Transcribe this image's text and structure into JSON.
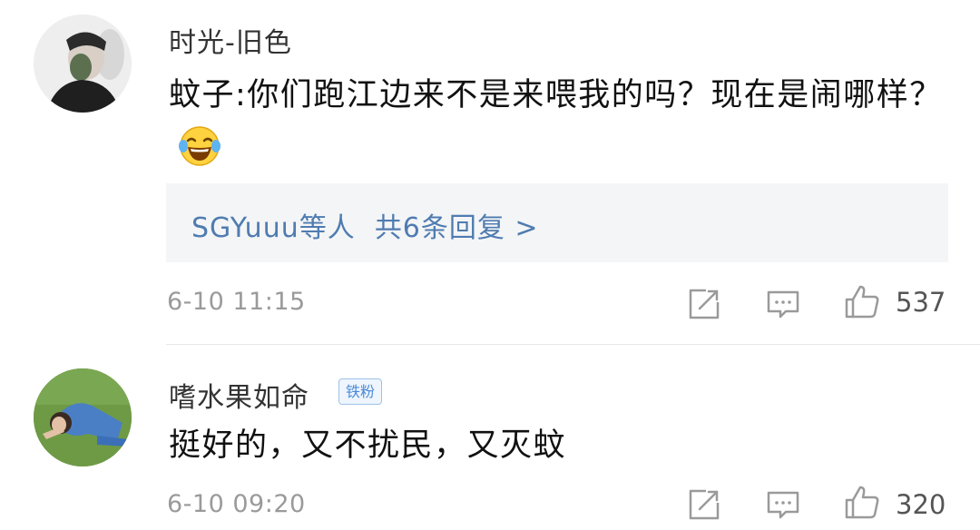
{
  "comments": [
    {
      "username": "时光-旧色",
      "text": "蚊子:你们跑江边来不是来喂我的吗？现在是闹哪样？",
      "emoji": "laughing-tears-emoji",
      "replies_prefix": "SGYuuu等人",
      "replies_count_text": "共6条回复 >",
      "timestamp": "6-10 11:15",
      "likes": "537"
    },
    {
      "username": "嗜水果如命",
      "badge": "铁粉",
      "text": "挺好的，又不扰民，又灭蚊",
      "timestamp": "6-10 09:20",
      "likes": "320"
    }
  ],
  "icons": {
    "share": "share-icon",
    "comment": "comment-icon",
    "like": "thumbs-up-icon"
  },
  "colors": {
    "link": "#4f7cb0",
    "meta": "#9a9a9a",
    "badge": "#4a8ad8"
  }
}
